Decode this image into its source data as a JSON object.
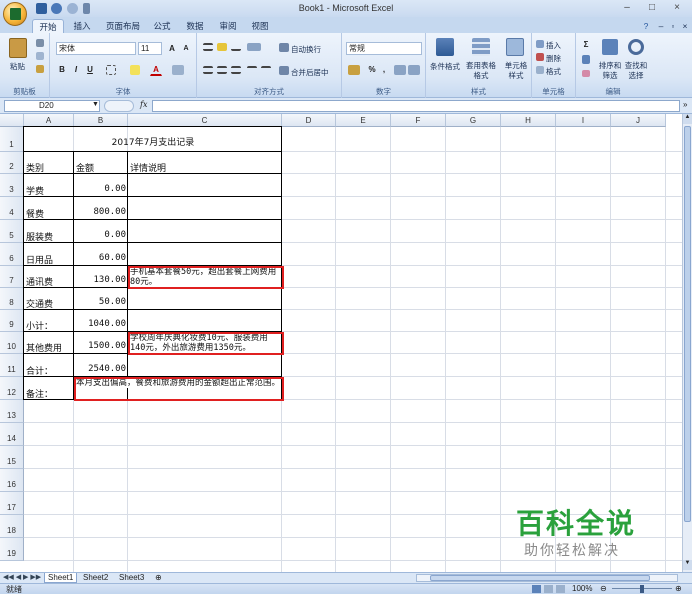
{
  "window": {
    "title": "Book1 - Microsoft Excel",
    "controls": [
      "–",
      "□",
      "×"
    ]
  },
  "ribbon_tabs": [
    "开始",
    "插入",
    "页面布局",
    "公式",
    "数据",
    "审阅",
    "视图"
  ],
  "ribbon": {
    "clipboard": {
      "paste": "粘贴",
      "group": "剪贴板"
    },
    "font": {
      "name": "宋体",
      "size": "11",
      "grow": "A",
      "shrink": "A",
      "bold": "B",
      "italic": "I",
      "underline": "U",
      "fontcolor": "A",
      "group": "字体"
    },
    "alignment": {
      "wrap": "自动换行",
      "merge": "合并后居中",
      "group": "对齐方式"
    },
    "number": {
      "format": "常规",
      "percent": "%",
      "comma": ",",
      "group": "数字"
    },
    "styles": {
      "conditional": "条件格式",
      "table": "套用表格格式",
      "cell": "单元格样式",
      "group": "样式"
    },
    "cells": {
      "insert": "插入",
      "delete": "删除",
      "format": "格式",
      "group": "单元格"
    },
    "editing": {
      "sigma": "Σ",
      "sort": "排序和筛选",
      "find": "查找和选择",
      "group": "编辑"
    }
  },
  "formula_bar": {
    "name_box": "D20",
    "fx": "fx",
    "formula": ""
  },
  "columns": [
    "A",
    "B",
    "C",
    "D",
    "E",
    "F",
    "G",
    "H",
    "I",
    "J"
  ],
  "rows": [
    "1",
    "2",
    "3",
    "4",
    "5",
    "6",
    "7",
    "8",
    "9",
    "10",
    "11",
    "12",
    "13",
    "14",
    "15",
    "16",
    "17",
    "18",
    "19"
  ],
  "table": {
    "title": "2017年7月支出记录",
    "headers": [
      "类别",
      "金额",
      "详情说明"
    ],
    "items": [
      {
        "cat": "学费",
        "amt": "0.00",
        "note": ""
      },
      {
        "cat": "餐费",
        "amt": "800.00",
        "note": ""
      },
      {
        "cat": "服装费",
        "amt": "0.00",
        "note": ""
      },
      {
        "cat": "日用品",
        "amt": "60.00",
        "note": ""
      },
      {
        "cat": "通讯费",
        "amt": "130.00",
        "note": "手机基本套餐50元，超出套餐上网费用80元。"
      },
      {
        "cat": "交通费",
        "amt": "50.00",
        "note": ""
      },
      {
        "cat": "小计：",
        "amt": "1040.00",
        "note": ""
      },
      {
        "cat": "其他费用",
        "amt": "1500.00",
        "note": "学校周年庆典化妆费10元、服装费用140元，外出旅游费用1350元。"
      },
      {
        "cat": "合计：",
        "amt": "2540.00",
        "note": ""
      }
    ],
    "remark_label": "备注：",
    "remark": "本月支出偏高，餐费和旅游费用的金额超出正常范围。"
  },
  "sheets": [
    "Sheet1",
    "Sheet2",
    "Sheet3"
  ],
  "status": {
    "ready": "就绪",
    "zoom": "100%"
  },
  "watermark": {
    "title": "百科全说",
    "subtitle": "助你轻松解决"
  }
}
